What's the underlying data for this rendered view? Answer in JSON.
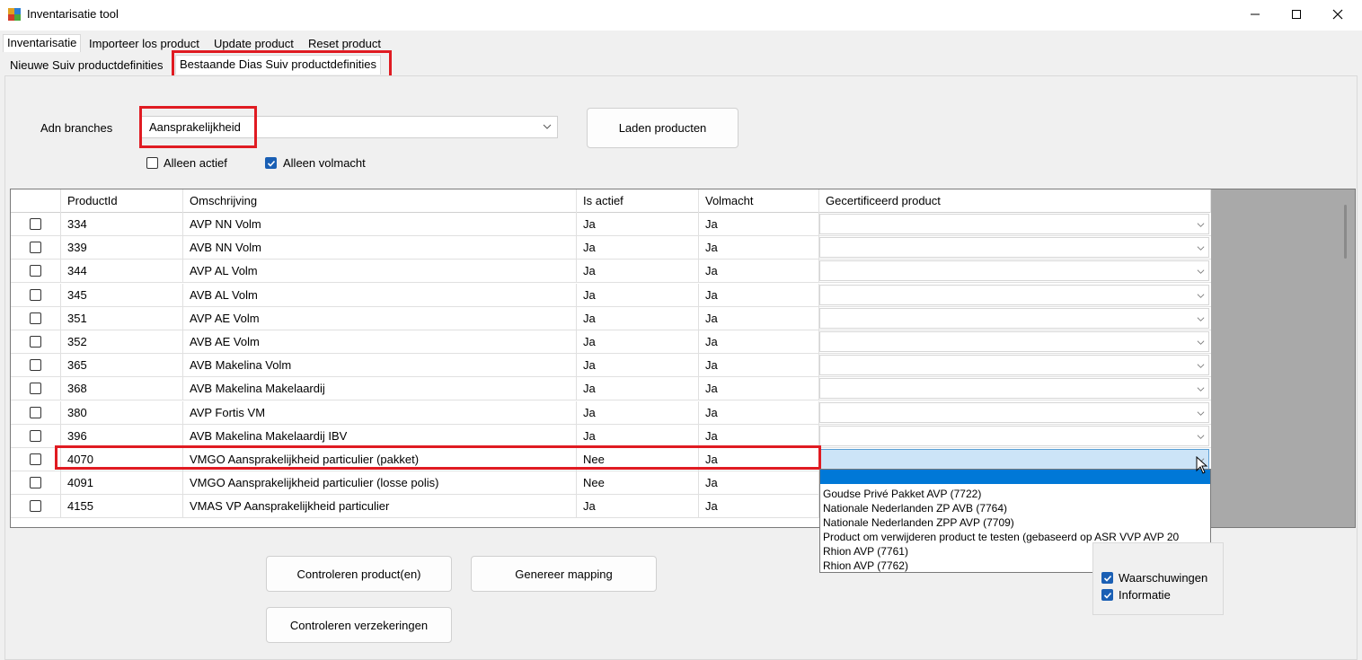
{
  "window": {
    "title": "Inventarisatie tool"
  },
  "tabs": [
    "Inventarisatie",
    "Importeer los product",
    "Update product",
    "Reset product"
  ],
  "subtabs": [
    "Nieuwe Suiv productdefinities",
    "Bestaande Dias Suiv productdefinities"
  ],
  "filters": {
    "branch_label": "Adn branches",
    "branch_value": "Aansprakelijkheid",
    "load_button": "Laden producten",
    "alleen_actief": "Alleen actief",
    "alleen_volmacht": "Alleen volmacht"
  },
  "grid": {
    "headers": [
      "ProductId",
      "Omschrijving",
      "Is actief",
      "Volmacht",
      "Gecertificeerd product"
    ],
    "rows": [
      {
        "id": "334",
        "desc": "AVP NN Volm",
        "actief": "Ja",
        "volmacht": "Ja"
      },
      {
        "id": "339",
        "desc": "AVB NN Volm",
        "actief": "Ja",
        "volmacht": "Ja"
      },
      {
        "id": "344",
        "desc": "AVP AL Volm",
        "actief": "Ja",
        "volmacht": "Ja"
      },
      {
        "id": "345",
        "desc": "AVB AL Volm",
        "actief": "Ja",
        "volmacht": "Ja"
      },
      {
        "id": "351",
        "desc": "AVP AE Volm",
        "actief": "Ja",
        "volmacht": "Ja"
      },
      {
        "id": "352",
        "desc": "AVB AE Volm",
        "actief": "Ja",
        "volmacht": "Ja"
      },
      {
        "id": "365",
        "desc": "AVB Makelina Volm",
        "actief": "Ja",
        "volmacht": "Ja"
      },
      {
        "id": "368",
        "desc": "AVB Makelina Makelaardij",
        "actief": "Ja",
        "volmacht": "Ja"
      },
      {
        "id": "380",
        "desc": "AVP Fortis VM",
        "actief": "Ja",
        "volmacht": "Ja"
      },
      {
        "id": "396",
        "desc": "AVB Makelina Makelaardij IBV",
        "actief": "Ja",
        "volmacht": "Ja"
      },
      {
        "id": "4070",
        "desc": "VMGO Aansprakelijkheid particulier (pakket)",
        "actief": "Nee",
        "volmacht": "Ja"
      },
      {
        "id": "4091",
        "desc": "VMGO Aansprakelijkheid particulier (losse polis)",
        "actief": "Nee",
        "volmacht": "Ja"
      },
      {
        "id": "4155",
        "desc": "VMAS VP Aansprakelijkheid particulier",
        "actief": "Ja",
        "volmacht": "Ja"
      }
    ]
  },
  "dropdown_options": [
    "Goudse Privé Pakket AVP (7722)",
    "Nationale Nederlanden ZP AVB (7764)",
    "Nationale Nederlanden ZPP AVP (7709)",
    "Product om verwijderen product te testen (gebaseerd op ASR VVP AVP 20",
    "Rhion AVP (7761)",
    "Rhion AVP (7762)"
  ],
  "actions": {
    "controleren_producten": "Controleren product(en)",
    "genereer_mapping": "Genereer mapping",
    "controleren_verzekeringen": "Controleren verzekeringen"
  },
  "log_filters": {
    "waarschuwingen": "Waarschuwingen",
    "informatie": "Informatie"
  },
  "colors": {
    "highlight": "#e01b22",
    "accent": "#1a5fb4",
    "selection": "#0078d7"
  }
}
